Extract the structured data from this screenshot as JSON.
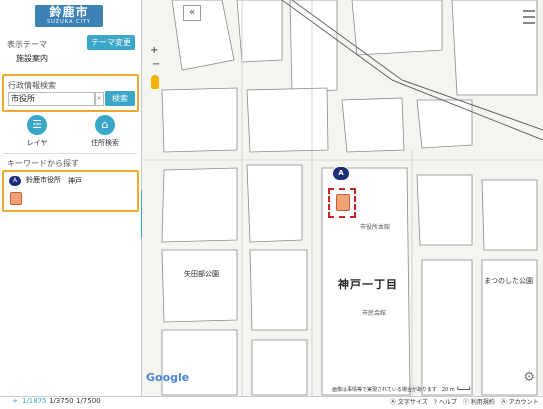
{
  "logo": {
    "main": "鈴鹿市",
    "sub": "SUZUKA CITY"
  },
  "sidebar": {
    "theme_label": "表示テーマ",
    "theme_value": "施設案内",
    "theme_button": "テーマ変更 ▶",
    "search": {
      "title": "行政情報検索",
      "value": "市役所",
      "clear": "×",
      "button": "検索"
    },
    "tools": [
      {
        "label": "レイヤ",
        "icon": "list-icon"
      },
      {
        "label": "住所検索",
        "icon": "home-icon"
      }
    ],
    "keyword_label": "キーワードから探す",
    "result": {
      "marker": "A",
      "name": "鈴鹿市役所",
      "area": "神戸"
    }
  },
  "map": {
    "back": "«",
    "zoom_in": "+",
    "zoom_out": "−",
    "block_label": "神戸一丁目",
    "park_label": "矢田部公園",
    "side_label": "まつのした公園",
    "building_1": "市役所本館",
    "building_2": "市民会館",
    "marker": "A",
    "google": "Google",
    "footer": "画像は事情等で実現されている場合があります　20 m ┗━━━┛"
  },
  "bottom": {
    "add": "+",
    "scale_1": "1/1875",
    "scale_2": "1/3750",
    "scale_3": "1/7500",
    "links": "Ⓐ 文字サイズ　? ヘルプ　Ⓘ 利用規約　Ⓐ アカウント"
  },
  "colors": {
    "accent": "#3aa6c8",
    "highlight": "#f0a830",
    "marker": "#1c2e7a",
    "pin": "#d02020"
  }
}
